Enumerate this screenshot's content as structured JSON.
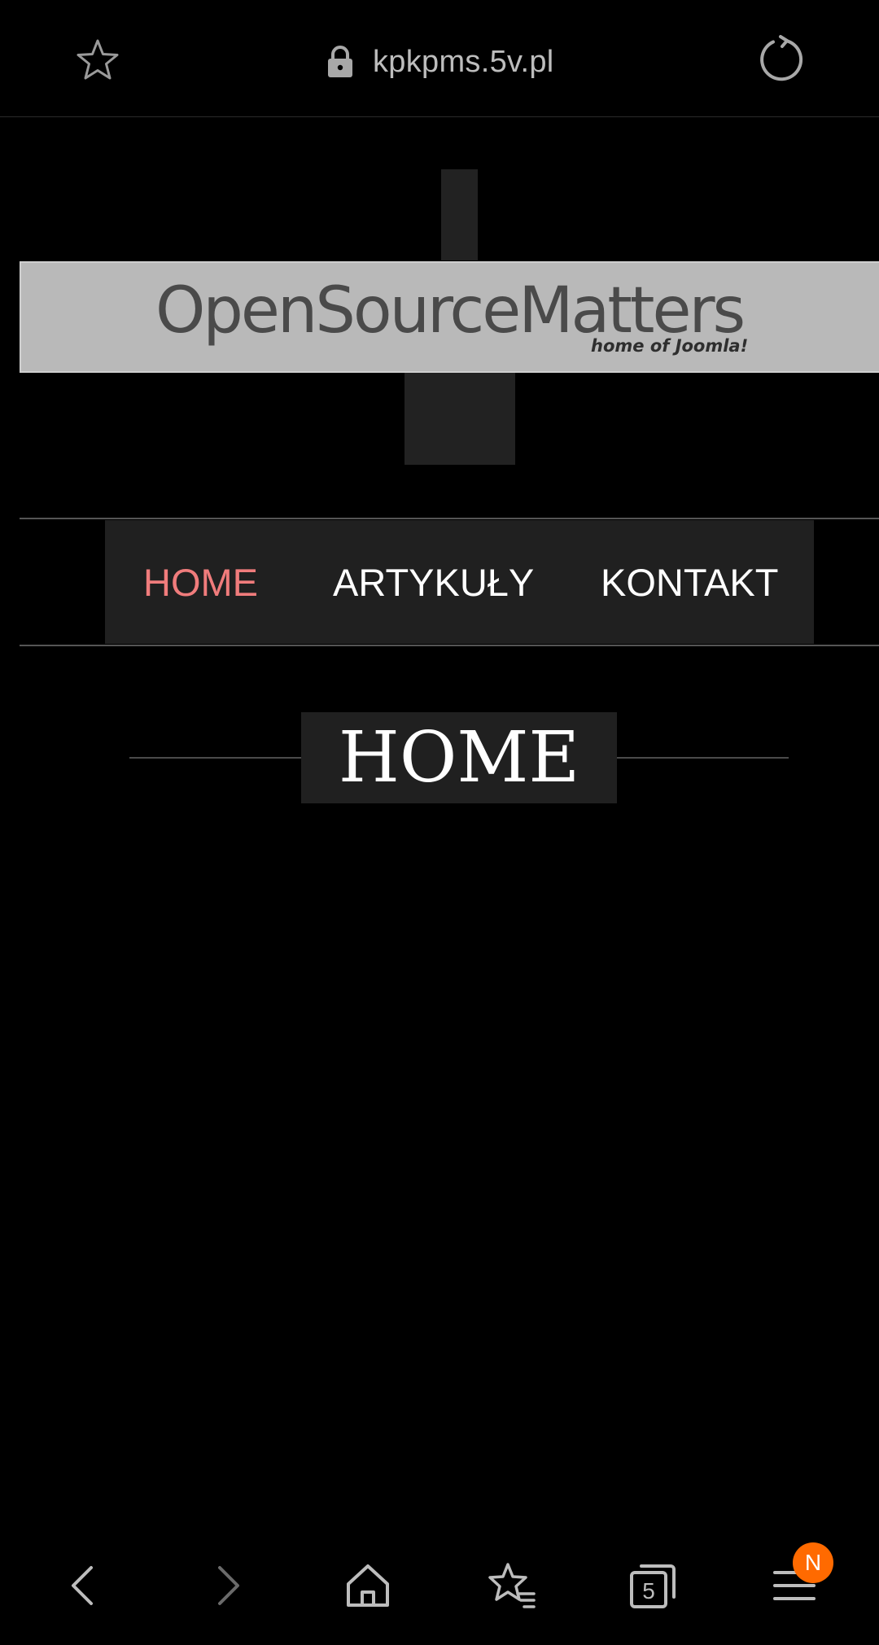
{
  "browser": {
    "url": "kpkpms.5v.pl",
    "icons": {
      "bookmark": "star-outline-icon",
      "secure": "lock-icon",
      "reload": "reload-icon"
    }
  },
  "logo": {
    "main": "OpenSourceMatters",
    "sub": "home of Joomla!"
  },
  "nav": {
    "items": [
      {
        "label": "HOME",
        "active": true
      },
      {
        "label": "ARTYKUŁY",
        "active": false
      },
      {
        "label": "KONTAKT",
        "active": false
      }
    ],
    "active_color": "#f07c7c"
  },
  "page": {
    "title": "HOME"
  },
  "toolbar": {
    "tabs_count": "5",
    "menu_badge": "N",
    "badge_color": "#ff6a00",
    "icons": [
      "back-icon",
      "forward-icon",
      "home-icon",
      "bookmarks-icon",
      "tabs-icon",
      "menu-icon"
    ]
  }
}
